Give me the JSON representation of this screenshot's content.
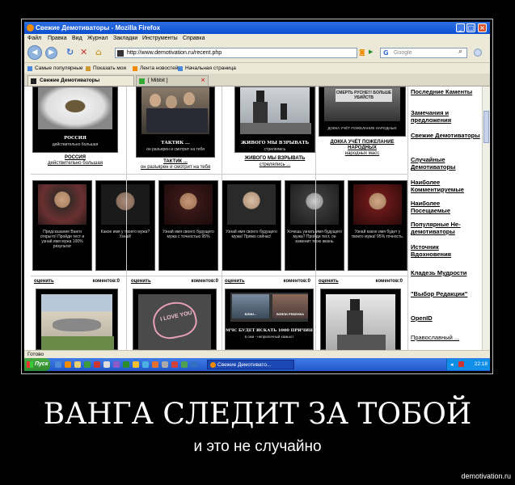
{
  "window": {
    "title": "Свежие Демотиваторы - Mozilla Firefox"
  },
  "menu": [
    "Файл",
    "Правка",
    "Вид",
    "Журнал",
    "Закладки",
    "Инструменты",
    "Справка"
  ],
  "navbar": {
    "url": "http://www.demotivation.ru/recent.php",
    "search_placeholder": "Google"
  },
  "bookmarks": [
    "Самые популярные",
    "Показать мои",
    "Лента новостей",
    "Начальная страница"
  ],
  "tabs": [
    {
      "label": "Свежие Демотиваторы"
    },
    {
      "label": "[ Mibbit ]"
    }
  ],
  "row1": [
    {
      "title": "РОССИЯ",
      "text": "действительно большая",
      "caption": "РОССИЯ",
      "caption2": "действительно большая"
    },
    {
      "title": "ТАКТИК ...",
      "text": "он разъярен и смотрит на тебя",
      "caption": "ТАКТИК ...",
      "caption2": "он разъярен и смотрит на тебя"
    },
    {
      "title": "ЖИВОГО МЫ ВЗРЫВАТЬ",
      "text": "стрелялись",
      "caption": "ЖИВОГО МЫ ВЗРЫВАТЬ",
      "caption2": "стрелялись ..."
    },
    {
      "title": "ДОККА УЧЁТ ПОЖЕЛАНИЕ НАРОДНЫХ",
      "text": "народных масс",
      "sign": "СМЕРТЬ РУСНЕ!!! БОЛЬШЕ УБИЙСТВ",
      "caption": "ДОККА УЧЁТ ПОЖЕЛАНИЕ НАРОДНЫХ",
      "caption2": "народных масс"
    }
  ],
  "vanga": [
    "Предсказание Ванги открыто! Пройди тест и узнай имя мужа 100% результат",
    "Какое имя у твоего мужа? Узнай!",
    "Узнай имя своего будущего мужа с точностью 95%",
    "Узнай имя своего будущего мужа! Прямо сейчас!",
    "Хочешь узнать имя будущего мужа? Пройди тест, он изменит твою жизнь",
    "Узнай какое имя будет у твоего мужа! 95% точность."
  ],
  "row3": {
    "rating_label": "оценить",
    "comments_label": "коментов:0",
    "items": [
      {
        "text": ""
      },
      {
        "text": "I LOVE YOU"
      },
      {
        "text": "МЧС БУДЕТ ИСКАТЬ 1000 ПРИЧИН",
        "sub": "в ожи - неприличный камшот",
        "caption": "МЧС БУДЕТ ИСКАТЬ 1000",
        "thumb_labels": [
          "БЛИН...",
          "ВЗЯЛИ РЕБЕНКА"
        ]
      },
      {
        "text": ""
      }
    ]
  },
  "sidebar": [
    "Последние Каменты",
    "Замечания и предложения",
    "Свежие Демотиваторы",
    "Случайные Демотиваторы",
    "Наиболее Комментируемые",
    "Наиболее Посещаемые",
    "Популярные Не-демотиваторы",
    "Источник Вдохновения",
    "Кладезь Мудрости",
    "\"Выбор Редакции\"",
    "OpenID",
    "Православный ..."
  ],
  "status": "Готово",
  "taskbar": {
    "start": "Пуск",
    "window_item": "Свежие Демотивато...",
    "time": "22:18"
  },
  "poster": {
    "heading": "ВАНГА СЛЕДИТ ЗА ТОБОЙ",
    "subtitle": "и это не случайно",
    "watermark": "demotivation.ru"
  },
  "colors": {
    "background": "#000000",
    "titlebar": "#0a4fd0",
    "chrome": "#ece9d8",
    "start_button": "#2e8a2c"
  }
}
